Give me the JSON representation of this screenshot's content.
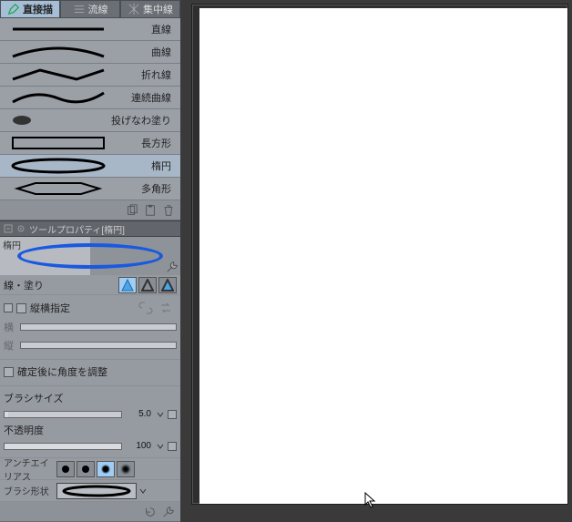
{
  "tabs": [
    {
      "label": "直接描",
      "active": true
    },
    {
      "label": "流線",
      "active": false
    },
    {
      "label": "集中線",
      "active": false
    }
  ],
  "tools": [
    {
      "id": "line",
      "label": "直線"
    },
    {
      "id": "curve",
      "label": "曲線"
    },
    {
      "id": "polyline",
      "label": "折れ線"
    },
    {
      "id": "continuous-curve",
      "label": "連続曲線"
    },
    {
      "id": "lasso-fill",
      "label": "投げなわ塗り"
    },
    {
      "id": "rectangle",
      "label": "長方形"
    },
    {
      "id": "ellipse",
      "label": "楕円"
    },
    {
      "id": "polygon",
      "label": "多角形"
    }
  ],
  "selected_tool_index": 6,
  "property_panel": {
    "header": "ツールプロパティ[楕円]",
    "preview_title": "楕円",
    "line_fill_label": "線・塗り",
    "aspect_lock": {
      "label": "縦横指定",
      "checked": false
    },
    "width_label": "横",
    "height_label": "縦",
    "fix_angle_after": {
      "label": "確定後に角度を調整",
      "checked": false
    },
    "brush_size": {
      "label": "ブラシサイズ",
      "value": "5.0"
    },
    "opacity": {
      "label": "不透明度",
      "value": "100"
    },
    "anti_alias": {
      "label": "アンチエイリアス",
      "selected": 2
    },
    "brush_shape": {
      "label": "ブラシ形状"
    }
  }
}
